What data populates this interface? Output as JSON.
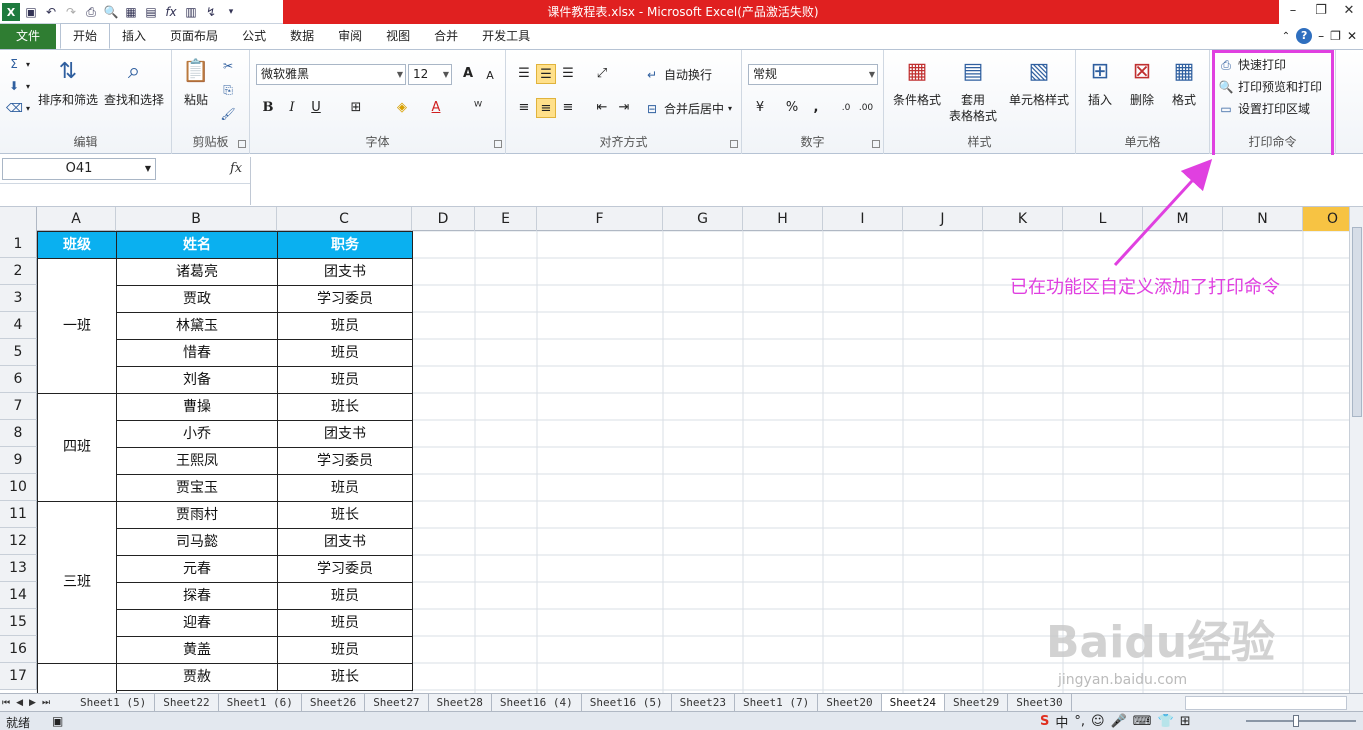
{
  "window": {
    "title": "课件教程表.xlsx - Microsoft Excel(产品激活失败)",
    "controls": [
      "–",
      "❐",
      "✕"
    ]
  },
  "qat_icons": [
    "excel-logo-icon",
    "save-icon",
    "undo-icon",
    "redo-icon",
    "print-icon",
    "print-preview-icon",
    "form-icon",
    "calculator-icon",
    "fx-icon",
    "chart-icon",
    "macro-icon"
  ],
  "tabs": [
    {
      "label": "文件"
    },
    {
      "label": "开始"
    },
    {
      "label": "插入"
    },
    {
      "label": "页面布局"
    },
    {
      "label": "公式"
    },
    {
      "label": "数据"
    },
    {
      "label": "审阅"
    },
    {
      "label": "视图"
    },
    {
      "label": "合并"
    },
    {
      "label": "开发工具"
    }
  ],
  "ribbon": {
    "editing": {
      "name": "编辑",
      "sort_filter": "排序和筛选",
      "find_select": "查找和选择"
    },
    "clipboard": {
      "name": "剪贴板",
      "paste": "粘贴"
    },
    "font": {
      "name": "字体",
      "font_name": "微软雅黑",
      "font_size": "12"
    },
    "alignment": {
      "name": "对齐方式",
      "wrap": "自动换行",
      "merge": "合并后居中"
    },
    "number": {
      "name": "数字",
      "format": "常规"
    },
    "styles": {
      "name": "样式",
      "conditional": "条件格式",
      "table_format_1": "套用",
      "table_format_2": "表格格式",
      "cell_styles": "单元格样式"
    },
    "cells": {
      "name": "单元格",
      "insert": "插入",
      "delete": "删除",
      "format": "格式"
    },
    "print": {
      "name": "打印命令",
      "quick_print": "快速打印",
      "preview_print": "打印预览和打印",
      "set_area": "设置打印区域"
    }
  },
  "formula_bar": {
    "name_box": "O41",
    "fx": "fx",
    "value": ""
  },
  "columns": [
    "A",
    "B",
    "C",
    "D",
    "E",
    "F",
    "G",
    "H",
    "I",
    "J",
    "K",
    "L",
    "M",
    "N",
    "O"
  ],
  "rows": [
    "1",
    "2",
    "3",
    "4",
    "5",
    "6",
    "7",
    "8",
    "9",
    "10",
    "11",
    "12",
    "13",
    "14",
    "15",
    "16",
    "17"
  ],
  "table": {
    "headers": [
      "班级",
      "姓名",
      "职务"
    ],
    "groups": [
      {
        "class": "一班",
        "rows": [
          [
            "诸葛亮",
            "团支书"
          ],
          [
            "贾政",
            "学习委员"
          ],
          [
            "林黛玉",
            "班员"
          ],
          [
            "惜春",
            "班员"
          ],
          [
            "刘备",
            "班员"
          ]
        ]
      },
      {
        "class": "四班",
        "rows": [
          [
            "曹操",
            "班长"
          ],
          [
            "小乔",
            "团支书"
          ],
          [
            "王熙凤",
            "学习委员"
          ],
          [
            "贾宝玉",
            "班员"
          ]
        ]
      },
      {
        "class": "三班",
        "rows": [
          [
            "贾雨村",
            "班长"
          ],
          [
            "司马懿",
            "团支书"
          ],
          [
            "元春",
            "学习委员"
          ],
          [
            "探春",
            "班员"
          ],
          [
            "迎春",
            "班员"
          ],
          [
            "黄盖",
            "班员"
          ]
        ]
      },
      {
        "class": "",
        "rows": [
          [
            "贾赦",
            "班长"
          ]
        ]
      }
    ]
  },
  "annotation": "已在功能区自定义添加了打印命令",
  "sheets": [
    "Sheet1 (5)",
    "Sheet22",
    "Sheet1 (6)",
    "Sheet26",
    "Sheet27",
    "Sheet28",
    "Sheet16 (4)",
    "Sheet16 (5)",
    "Sheet23",
    "Sheet1 (7)",
    "Sheet20",
    "Sheet24",
    "Sheet29",
    "Sheet30"
  ],
  "active_sheet": "Sheet24",
  "status": {
    "text": "就绪"
  },
  "watermark": {
    "main": "Baidu经验",
    "sub": "jingyan.baidu.com"
  },
  "colors": {
    "title_red": "#e02020",
    "file_tab": "#2f7d32",
    "header_fill": "#0ab0f0",
    "highlight": "#e040e0"
  }
}
